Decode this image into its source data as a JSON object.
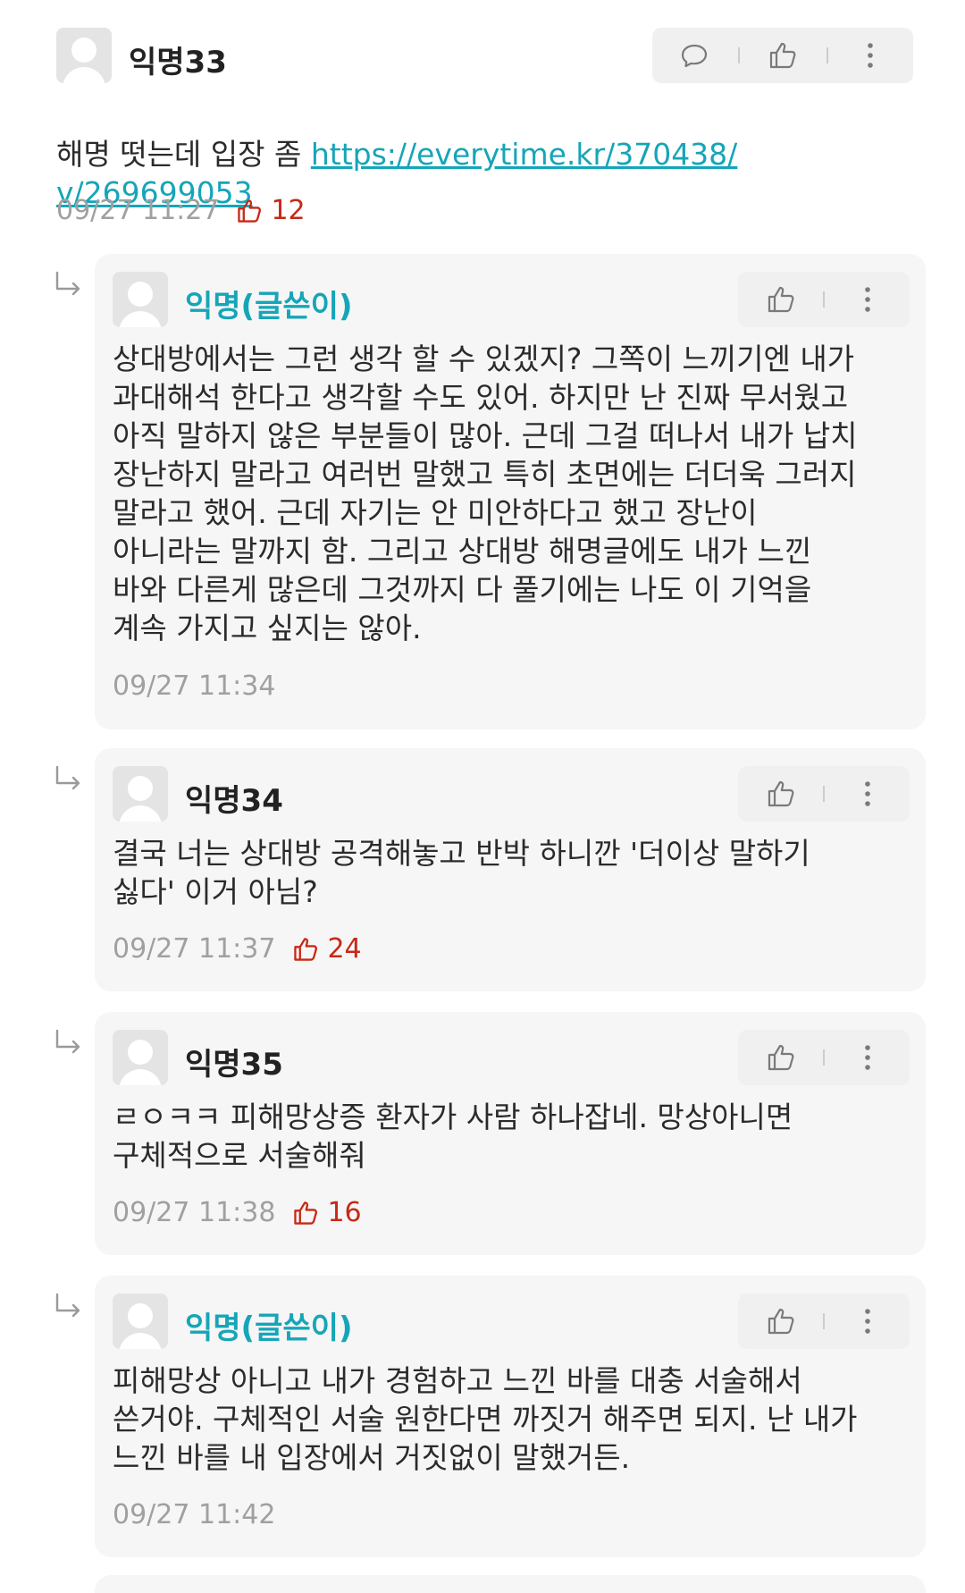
{
  "comments": [
    {
      "author": "익명33",
      "is_op": false,
      "text_before_link": "해명 떳는데 입장 좀 ",
      "link_text": "https://everytime.kr/370438/\nv/269699053",
      "timestamp": "09/27 11:27",
      "likes": "12",
      "actions": [
        "reply-icon",
        "like-icon",
        "more-icon"
      ]
    }
  ],
  "replies": [
    {
      "author": "익명(글쓴이)",
      "is_op": true,
      "text": "상대방에서는 그런 생각 할 수 있겠지? 그쪽이 느끼기엔 내가\n과대해석 한다고 생각할 수도 있어. 하지만 난 진짜 무서웠고\n아직 말하지 않은 부분들이 많아. 근데 그걸 떠나서 내가 납치\n장난하지 말라고 여러번 말했고 특히 초면에는 더더욱 그러지\n말라고 했어. 근데 자기는 안 미안하다고 했고 장난이\n아니라는 말까지 함. 그리고 상대방 해명글에도 내가 느낀\n바와 다른게 많은데 그것까지 다 풀기에는 나도 이 기억을\n계속 가지고 싶지는 않아.",
      "timestamp": "09/27 11:34",
      "likes": ""
    },
    {
      "author": "익명34",
      "is_op": false,
      "text": "결국 너는 상대방 공격해놓고 반박 하니깐 '더이상 말하기\n싫다' 이거 아님?",
      "timestamp": "09/27 11:37",
      "likes": "24"
    },
    {
      "author": "익명35",
      "is_op": false,
      "text": "ㄹㅇㅋㅋ 피해망상증 환자가 사람 하나잡네. 망상아니면\n구체적으로 서술해줘",
      "timestamp": "09/27 11:38",
      "likes": "16"
    },
    {
      "author": "익명(글쓴이)",
      "is_op": true,
      "text": "피해망상 아니고 내가 경험하고 느낀 바를 대충 서술해서\n쓴거야. 구체적인 서술 원한다면 까짓거 해주면 되지. 난 내가\n느낀 바를 내 입장에서 거짓없이 말했거든.",
      "timestamp": "09/27 11:42",
      "likes": ""
    }
  ],
  "colors": {
    "op_name": "#16a5b8",
    "link": "#16a5b8",
    "like_count": "#c62917",
    "timestamp": "#a0a0a0",
    "card_bg": "#f6f6f6"
  }
}
